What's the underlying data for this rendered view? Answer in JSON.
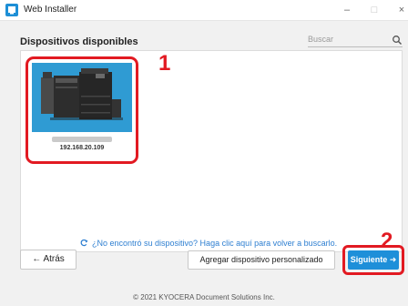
{
  "window": {
    "title": "Web Installer",
    "controls": {
      "minimize": "–",
      "maximize": "□",
      "close": "×"
    }
  },
  "main": {
    "heading": "Dispositivos disponibles",
    "search": {
      "placeholder": "Buscar",
      "value": ""
    },
    "devices": [
      {
        "ip": "192.168.20.109",
        "icon": "printer-icon"
      }
    ],
    "rescan_text": "¿No encontró su dispositivo? Haga clic aquí para volver a buscarlo."
  },
  "buttons": {
    "back_label": "Atrás",
    "add_custom_label": "Agregar dispositivo personalizado",
    "next_label": "Siguiente"
  },
  "callouts": {
    "step1": "1",
    "step2": "2"
  },
  "footer": {
    "copyright": "© 2021 KYOCERA Document Solutions Inc."
  },
  "colors": {
    "accent_blue": "#1e8fd9",
    "callout_red": "#e21a22",
    "link_blue": "#2e7fd1",
    "device_bg": "#2f9bd3"
  }
}
